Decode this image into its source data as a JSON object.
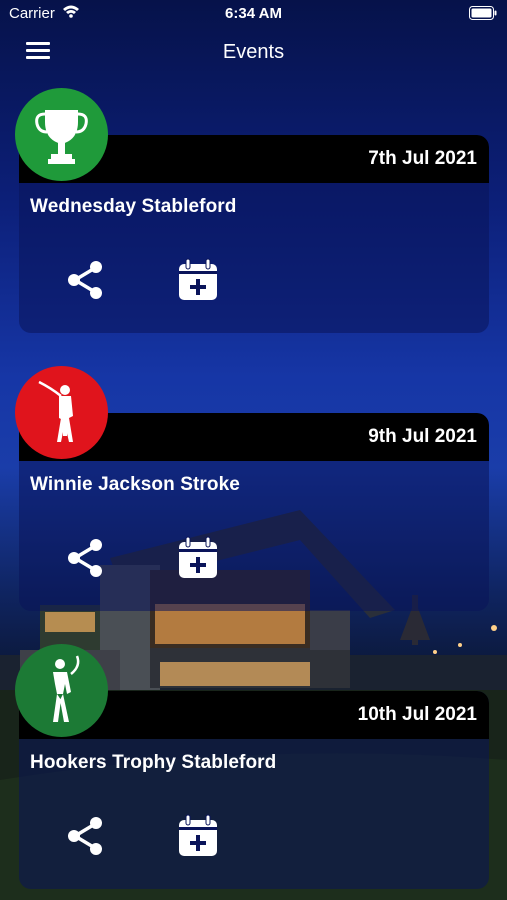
{
  "status_bar": {
    "carrier": "Carrier",
    "time": "6:34 AM"
  },
  "nav": {
    "title": "Events"
  },
  "events": [
    {
      "date": "7th Jul 2021",
      "name": "Wednesday Stableford",
      "badge_color": "#1f9a3a",
      "badge_icon": "trophy-icon"
    },
    {
      "date": "9th Jul 2021",
      "name": "Winnie Jackson Stroke",
      "badge_color": "#e0141c",
      "badge_icon": "female-golfer-icon"
    },
    {
      "date": "10th Jul 2021",
      "name": "Hookers Trophy Stableford",
      "badge_color": "#1c7a35",
      "badge_icon": "male-golfer-icon"
    }
  ],
  "colors": {
    "header": "#000000",
    "card": "#0a145a"
  }
}
